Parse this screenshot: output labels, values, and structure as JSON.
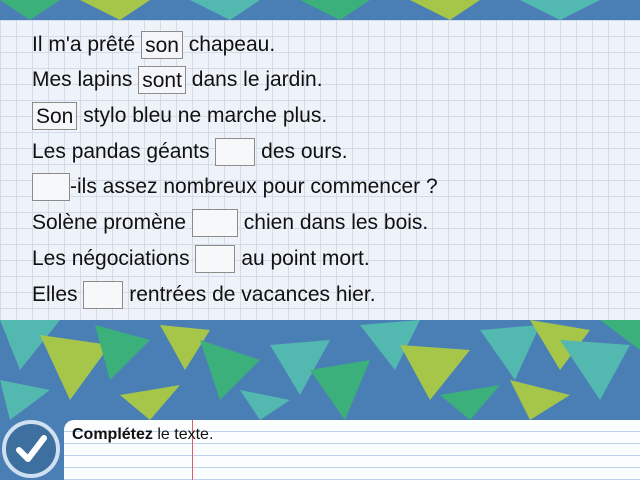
{
  "exercise": {
    "lines": [
      {
        "before": "Il m'a prêté",
        "answer": "son",
        "after": "chapeau."
      },
      {
        "before": "Mes lapins",
        "answer": "sont",
        "after": "dans le jardin."
      },
      {
        "before": "",
        "answer": "Son",
        "after": "stylo bleu ne marche plus."
      },
      {
        "before": "Les pandas géants",
        "answer": "",
        "after": "des ours."
      },
      {
        "before": "",
        "answer": "",
        "after": "-ils assez nombreux pour commencer ?"
      },
      {
        "before": "Solène promène",
        "answer": "",
        "after": "chien dans les bois."
      },
      {
        "before": "Les négociations",
        "answer": "",
        "after": "au point mort."
      },
      {
        "before": "Elles",
        "answer": "",
        "after": "rentrées de vacances hier."
      }
    ]
  },
  "footer": {
    "instruction_bold": "Complétez",
    "instruction_rest": " le texte."
  },
  "colors": {
    "background": "#4a7fb5",
    "triangle_green": "#3bb07a",
    "triangle_lime": "#a6c64a",
    "triangle_teal": "#52b8b0",
    "check_button": "#3d6f9f"
  },
  "icons": {
    "check_button": "check-icon"
  }
}
